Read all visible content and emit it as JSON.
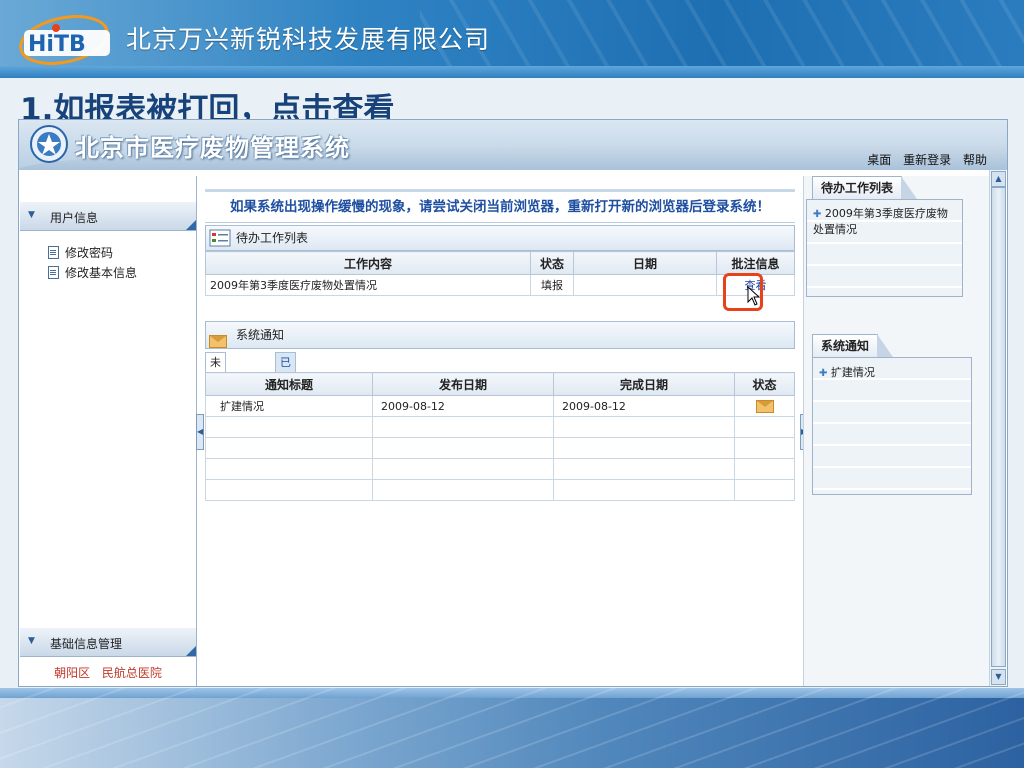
{
  "slide": {
    "company": "北京万兴新锐科技发展有限公司",
    "title": "1.如报表被打回，点击查看"
  },
  "system": {
    "title": "北京市医疗废物管理系统",
    "toplinks": [
      "桌面",
      "重新登录",
      "帮助"
    ]
  },
  "left": {
    "section1": "用户信息",
    "links": [
      "修改密码",
      "修改基本信息"
    ],
    "section2": "基础信息管理",
    "footer": [
      "朝阳区",
      "民航总医院"
    ]
  },
  "center": {
    "warning": "如果系统出现操作缓慢的现象，请尝试关闭当前浏览器，重新打开新的浏览器后登录系统！",
    "tasks": {
      "title": "待办工作列表",
      "columns": [
        "工作内容",
        "状态",
        "日期",
        "批注信息"
      ],
      "rows": [
        {
          "content": "2009年第3季度医疗废物处置情况",
          "status": "填报",
          "date": "",
          "note": "查看"
        }
      ]
    },
    "notices": {
      "title": "系统通知",
      "tabs": [
        "未阅读通知",
        "已阅读通知"
      ],
      "columns": [
        "通知标题",
        "发布日期",
        "完成日期",
        "状态"
      ],
      "rows": [
        {
          "title": "扩建情况",
          "publish": "2009-08-12",
          "finish": "2009-08-12"
        }
      ]
    }
  },
  "right": {
    "tasks_title": "待办工作列表",
    "tasks_item": "2009年第3季度医疗废物处置情况",
    "notice_title": "系统通知",
    "notice_item": "扩建情况"
  }
}
